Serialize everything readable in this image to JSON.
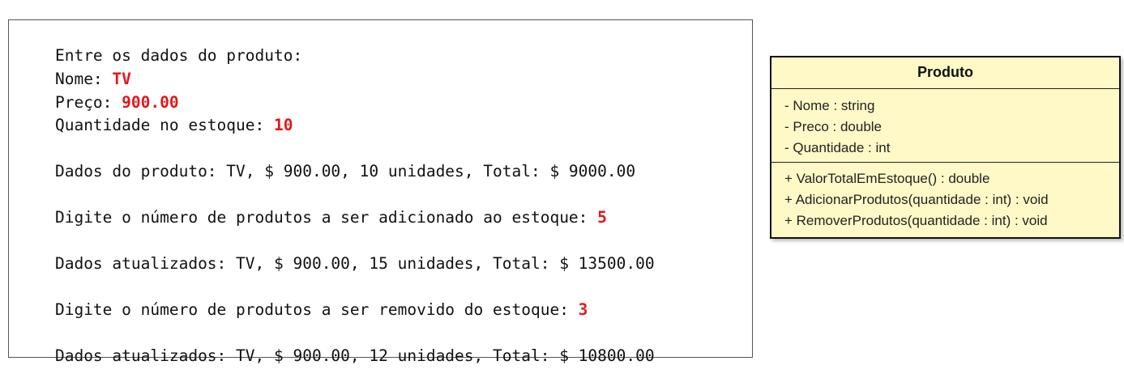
{
  "console": {
    "lines": [
      {
        "text": "Entre os dados do produto:",
        "value": ""
      },
      {
        "text": "Nome: ",
        "value": "TV"
      },
      {
        "text": "Preço: ",
        "value": "900.00"
      },
      {
        "text": "Quantidade no estoque: ",
        "value": "10"
      },
      {
        "text": "Dados do produto: TV, $ 900.00, 10 unidades, Total: $ 9000.00",
        "value": ""
      },
      {
        "text": "Digite o número de produtos a ser adicionado ao estoque: ",
        "value": "5"
      },
      {
        "text": "Dados atualizados: TV, $ 900.00, 15 unidades, Total: $ 13500.00",
        "value": ""
      },
      {
        "text": "Digite o número de produtos a ser removido do estoque: ",
        "value": "3"
      },
      {
        "text": "Dados atualizados: TV, $ 900.00, 12 unidades, Total: $ 10800.00",
        "value": ""
      }
    ],
    "input_color": "#e4171b"
  },
  "uml": {
    "class_name": "Produto",
    "attributes": [
      "- Nome : string",
      "- Preco : double",
      "- Quantidade : int"
    ],
    "methods": [
      "+ ValorTotalEmEstoque() : double",
      "+ AdicionarProdutos(quantidade : int) : void",
      "+ RemoverProdutos(quantidade : int) : void"
    ],
    "fill_color": "#fff8c7"
  }
}
